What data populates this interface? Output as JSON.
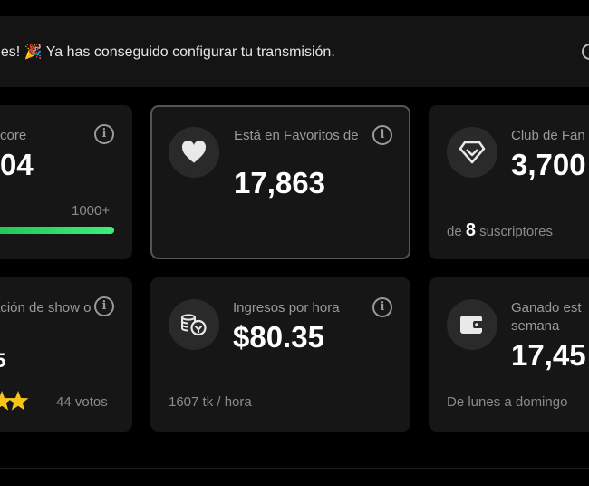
{
  "banner": {
    "message": "des! 🎉 Ya has conseguido configurar tu transmisión."
  },
  "cards": {
    "score": {
      "label": "core",
      "value": "04",
      "progress_label": "1000+",
      "progress_fraction": 1.0
    },
    "favorites": {
      "label": "Está en Favoritos de",
      "value": "17,863"
    },
    "fanclub": {
      "label": "Club de Fan",
      "value": "3,700",
      "foot_prefix": "de",
      "foot_count": "8",
      "foot_suffix": "suscriptores"
    },
    "rating": {
      "label": "ación de show o",
      "value": "5",
      "votes": "44 votos",
      "stars_visible": 2
    },
    "hourly": {
      "label": "Ingresos por hora",
      "value": "$80.35",
      "foot": "1607 tk / hora"
    },
    "weekly": {
      "label": "Ganado est semana",
      "value": "17,45",
      "foot": "De lunes a domingo"
    }
  },
  "colors": {
    "background": "#000000",
    "card": "#161616",
    "accent_green": "#2fe36c",
    "star": "#f5c518"
  },
  "icons": [
    "info-icon",
    "heart-icon",
    "diamond-icon",
    "coins-icon",
    "wallet-icon",
    "star-icon"
  ]
}
